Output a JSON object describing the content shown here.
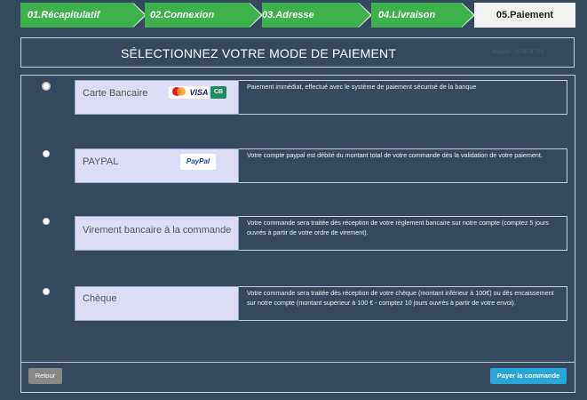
{
  "steps": [
    {
      "label": "01.Récapitulatif",
      "state": "done"
    },
    {
      "label": "02.Connexion",
      "state": "done"
    },
    {
      "label": "03.Adresse",
      "state": "done"
    },
    {
      "label": "04.Livraison",
      "state": "done"
    },
    {
      "label": "05.Paiement",
      "state": "active"
    }
  ],
  "title": "SÉLECTIONNEZ VOTRE MODE DE PAIEMENT",
  "title_faint": "Bonjour : 07.07.4.773",
  "methods": [
    {
      "label": "Carte Bancaire",
      "description": "Paiement immédiat, effectué avec le système de paiement sécurisé de la banque",
      "selected": true,
      "logos": {
        "mastercard": "MasterCard",
        "visa": "VISA",
        "cb": "CB"
      }
    },
    {
      "label": "PAYPAL",
      "description": "Votre compte paypal est débité du montant total de votre commande dès la validation de votre paiement.",
      "selected": false,
      "logos": {
        "paypal": "PayPal"
      }
    },
    {
      "label": "Virement bancaire à la commande",
      "description": "Votre commande sera traitée dès réception de votre règlement bancaire sur notre compte (comptez 5 jours ouvrés à partir de votre ordre de virement).",
      "selected": false
    },
    {
      "label": "Chèque",
      "description": "Votre commande sera traitée dès réception de votre chèque (montant inférieur à 100€) ou dès encaissement sur notre compte (montant supérieur à 100 € - comptez 10 jours ouvrés à partir de votre envoi).",
      "selected": false
    }
  ],
  "buttons": {
    "back": "Retour",
    "pay": "Payer la commande"
  },
  "colors": {
    "background": "#34495e",
    "step_done": "#3db14c",
    "option_bg": "#dcdcf6",
    "pay_button": "#2aa5d8",
    "back_button": "#888888"
  }
}
